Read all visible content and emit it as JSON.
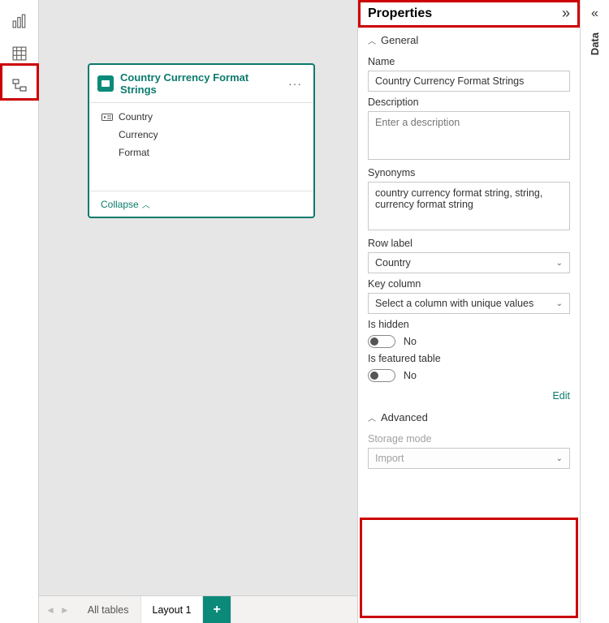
{
  "properties": {
    "title": "Properties",
    "sections": {
      "general": "General",
      "advanced": "Advanced"
    },
    "name": {
      "label": "Name",
      "value": "Country Currency Format Strings"
    },
    "description": {
      "label": "Description",
      "placeholder": "Enter a description"
    },
    "synonyms": {
      "label": "Synonyms",
      "value": "country currency format string, string, currency format string"
    },
    "rowLabel": {
      "label": "Row label",
      "value": "Country"
    },
    "keyColumn": {
      "label": "Key column",
      "value": "Select a column with unique values"
    },
    "isHidden": {
      "label": "Is hidden",
      "value": "No"
    },
    "featured": {
      "label": "Is featured table",
      "value": "No"
    },
    "editLink": "Edit",
    "storageMode": {
      "label": "Storage mode",
      "value": "Import"
    }
  },
  "table": {
    "title": "Country Currency Format Strings",
    "fields": [
      "Country",
      "Currency",
      "Format"
    ],
    "collapse": "Collapse"
  },
  "tabs": {
    "all": "All tables",
    "layout": "Layout 1",
    "add": "+"
  },
  "dataPane": {
    "label": "Data"
  }
}
